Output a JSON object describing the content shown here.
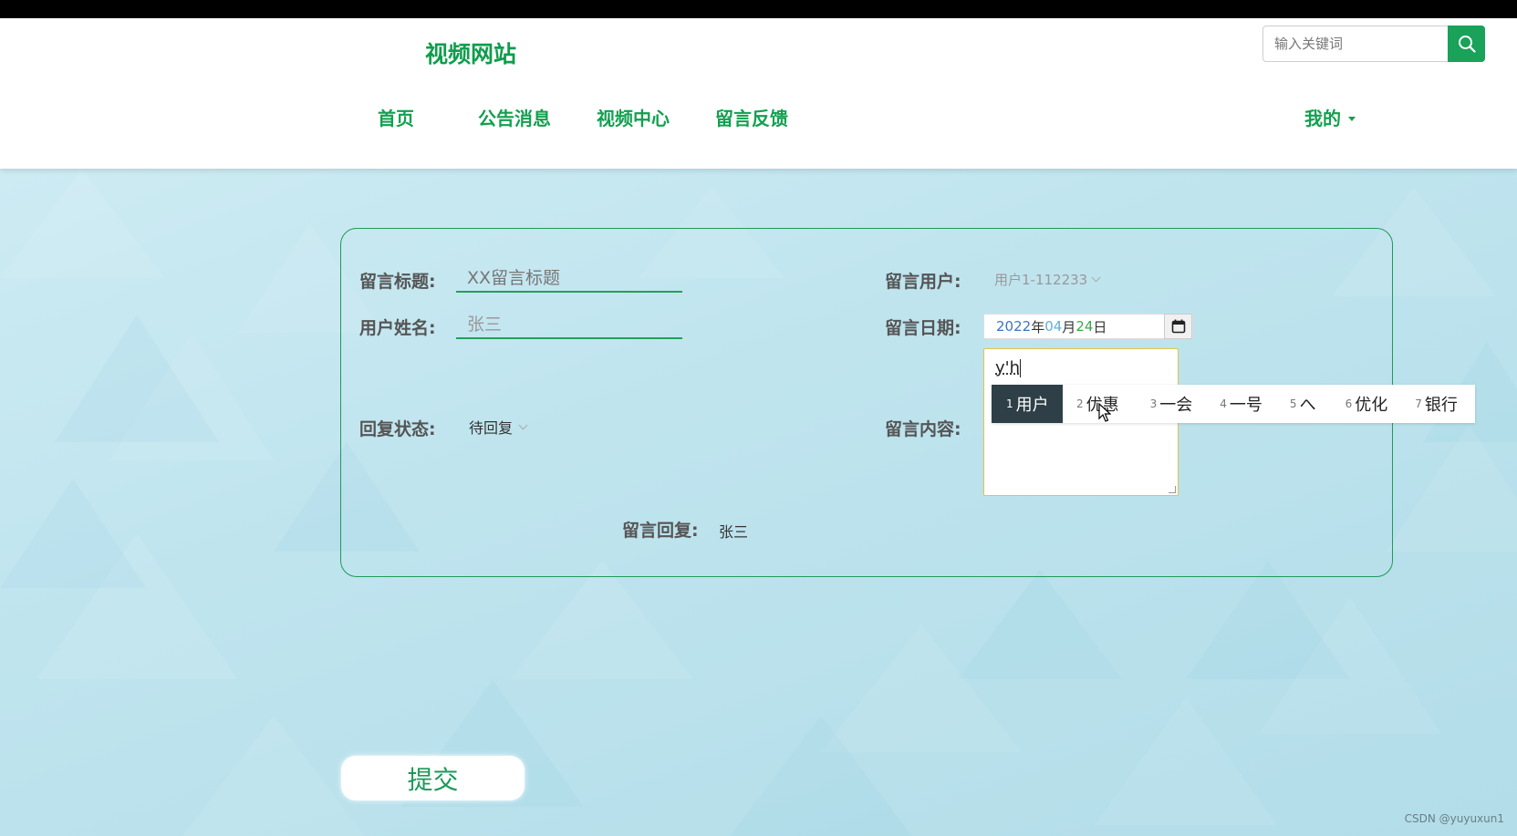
{
  "site": {
    "logo": "视频网站"
  },
  "search": {
    "placeholder": "输入关键词",
    "button_icon": "search-icon"
  },
  "nav": {
    "items": [
      {
        "label": "首页"
      },
      {
        "label": "公告消息"
      },
      {
        "label": "视频中心"
      },
      {
        "label": "留言反馈"
      }
    ],
    "mine": "我的"
  },
  "form": {
    "title_label": "留言标题:",
    "title_value": "XX留言标题",
    "name_label": "用户姓名:",
    "name_value": "张三",
    "user_label": "留言用户:",
    "user_value": "用户1-112233",
    "date_label": "留言日期:",
    "date": {
      "year": "2022",
      "y_char": "年",
      "month": "04",
      "m_char": "月",
      "day": "24",
      "d_char": "日"
    },
    "status_label": "回复状态:",
    "status_value": "待回复",
    "content_label": "留言内容:",
    "content_typed": "y'h",
    "reply_label": "留言回复:",
    "reply_value": "张三"
  },
  "ime": {
    "candidates": [
      {
        "num": "1",
        "text": "用户"
      },
      {
        "num": "2",
        "text": "优惠"
      },
      {
        "num": "3",
        "text": "一会"
      },
      {
        "num": "4",
        "text": "一号"
      },
      {
        "num": "5",
        "text": "へ"
      },
      {
        "num": "6",
        "text": "优化"
      },
      {
        "num": "7",
        "text": "银行"
      }
    ]
  },
  "submit_label": "提交",
  "watermark": "CSDN @yuyuxun1",
  "colors": {
    "brand_green": "#12a04f",
    "search_btn": "#1aa15a",
    "ime_active": "#2e3f47"
  }
}
